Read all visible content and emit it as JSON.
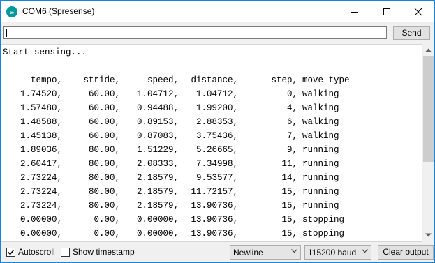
{
  "window": {
    "title": "COM6 (Spresense)"
  },
  "send_row": {
    "input_value": "",
    "send_label": "Send"
  },
  "output": {
    "start_line": "Start sensing...",
    "rule": "------------------------------------------------------------------------",
    "columns": [
      "tempo,",
      "stride,",
      "speed,",
      "distance,",
      "step,",
      "move-type"
    ],
    "rows": [
      [
        "1.74520,",
        "60.00,",
        "1.04712,",
        "1.04712,",
        "0,",
        "walking"
      ],
      [
        "1.57480,",
        "60.00,",
        "0.94488,",
        "1.99200,",
        "4,",
        "walking"
      ],
      [
        "1.48588,",
        "60.00,",
        "0.89153,",
        "2.88353,",
        "6,",
        "walking"
      ],
      [
        "1.45138,",
        "60.00,",
        "0.87083,",
        "3.75436,",
        "7,",
        "walking"
      ],
      [
        "1.89036,",
        "80.00,",
        "1.51229,",
        "5.26665,",
        "9,",
        "running"
      ],
      [
        "2.60417,",
        "80.00,",
        "2.08333,",
        "7.34998,",
        "11,",
        "running"
      ],
      [
        "2.73224,",
        "80.00,",
        "2.18579,",
        "9.53577,",
        "14,",
        "running"
      ],
      [
        "2.73224,",
        "80.00,",
        "2.18579,",
        "11.72157,",
        "15,",
        "running"
      ],
      [
        "2.73224,",
        "80.00,",
        "2.18579,",
        "13.90736,",
        "15,",
        "running"
      ],
      [
        "0.00000,",
        "0.00,",
        "0.00000,",
        "13.90736,",
        "15,",
        "stopping"
      ],
      [
        "0.00000,",
        "0.00,",
        "0.00000,",
        "13.90736,",
        "15,",
        "stopping"
      ]
    ]
  },
  "bottom_bar": {
    "autoscroll_label": "Autoscroll",
    "autoscroll_checked": true,
    "timestamp_label": "Show timestamp",
    "timestamp_checked": false,
    "line_ending": "Newline",
    "baud_rate": "115200 baud",
    "clear_label": "Clear output"
  },
  "icons": {
    "app": "arduino-icon",
    "minimize": "minimize-icon",
    "maximize": "maximize-icon",
    "close": "close-icon"
  },
  "colors": {
    "window_border": "#1883d7",
    "app_icon": "#00979c",
    "scroll_thumb": "#cdcdcd"
  }
}
